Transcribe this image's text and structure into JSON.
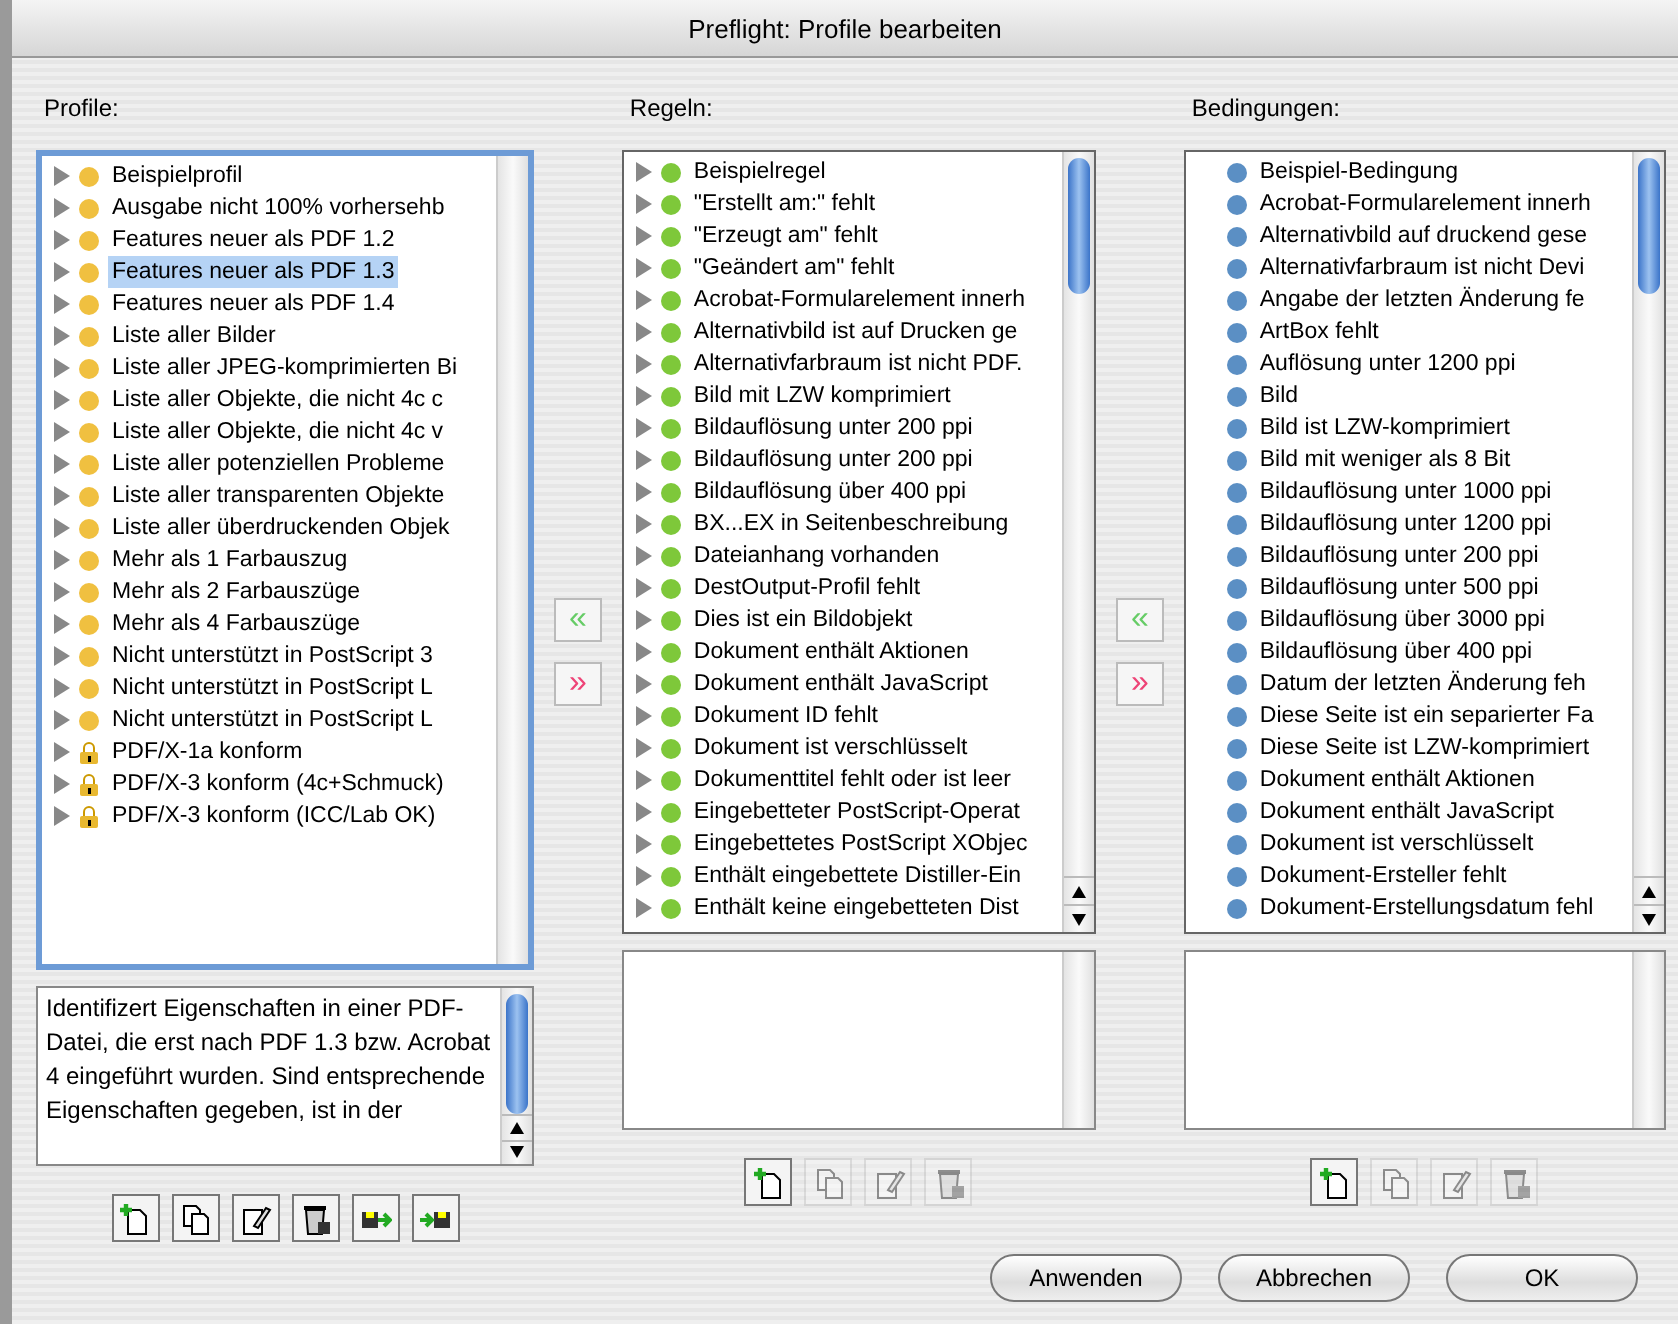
{
  "window": {
    "title": "Preflight: Profile bearbeiten"
  },
  "profiles": {
    "label": "Profile:",
    "items": [
      {
        "label": "Beispielprofil",
        "kind": "profile",
        "selected": false
      },
      {
        "label": "Ausgabe nicht 100% vorhersehb",
        "kind": "profile",
        "selected": false
      },
      {
        "label": "Features neuer als PDF 1.2",
        "kind": "profile",
        "selected": false
      },
      {
        "label": "Features neuer als PDF 1.3",
        "kind": "profile",
        "selected": true
      },
      {
        "label": "Features neuer als PDF 1.4",
        "kind": "profile",
        "selected": false
      },
      {
        "label": "Liste aller Bilder",
        "kind": "profile",
        "selected": false
      },
      {
        "label": "Liste aller JPEG-komprimierten Bi",
        "kind": "profile",
        "selected": false
      },
      {
        "label": "Liste aller Objekte, die nicht 4c c",
        "kind": "profile",
        "selected": false
      },
      {
        "label": "Liste aller Objekte, die nicht 4c v",
        "kind": "profile",
        "selected": false
      },
      {
        "label": "Liste aller potenziellen Probleme",
        "kind": "profile",
        "selected": false
      },
      {
        "label": "Liste aller transparenten Objekte",
        "kind": "profile",
        "selected": false
      },
      {
        "label": "Liste aller überdruckenden Objek",
        "kind": "profile",
        "selected": false
      },
      {
        "label": "Mehr als 1 Farbauszug",
        "kind": "profile",
        "selected": false
      },
      {
        "label": "Mehr als 2 Farbauszüge",
        "kind": "profile",
        "selected": false
      },
      {
        "label": "Mehr als 4 Farbauszüge",
        "kind": "profile",
        "selected": false
      },
      {
        "label": "Nicht unterstützt in PostScript 3",
        "kind": "profile",
        "selected": false
      },
      {
        "label": "Nicht unterstützt in PostScript L",
        "kind": "profile",
        "selected": false
      },
      {
        "label": "Nicht unterstützt in PostScript L",
        "kind": "profile",
        "selected": false
      },
      {
        "label": "PDF/X-1a konform",
        "kind": "locked",
        "selected": false
      },
      {
        "label": "PDF/X-3 konform (4c+Schmuck)",
        "kind": "locked",
        "selected": false
      },
      {
        "label": "PDF/X-3 konform (ICC/Lab OK)",
        "kind": "locked",
        "selected": false
      }
    ],
    "description": "Identifizert Eigenschaften in einer PDF-Datei, die erst nach PDF 1.3 bzw. Acrobat 4 eingeführt wurden. Sind entsprechende Eigenschaften gegeben, ist in der",
    "tools": [
      {
        "kind": "new",
        "disabled": false
      },
      {
        "kind": "duplicate",
        "disabled": false
      },
      {
        "kind": "edit",
        "disabled": false
      },
      {
        "kind": "delete",
        "disabled": false
      },
      {
        "kind": "export",
        "disabled": false
      },
      {
        "kind": "import",
        "disabled": false
      }
    ]
  },
  "transfer_1": {
    "add": "«",
    "remove": "»"
  },
  "rules": {
    "label": "Regeln:",
    "items": [
      "Beispielregel",
      "\"Erstellt am:\" fehlt",
      "\"Erzeugt am\" fehlt",
      "\"Geändert am\" fehlt",
      "Acrobat-Formularelement innerh",
      "Alternativbild ist auf Drucken ge",
      "Alternativfarbraum ist nicht PDF.",
      "Bild mit LZW komprimiert",
      "Bildauflösung unter 200 ppi",
      "Bildauflösung unter 200 ppi",
      "Bildauflösung über 400 ppi",
      "BX...EX in Seitenbeschreibung",
      "Dateianhang vorhanden",
      "DestOutput-Profil fehlt",
      "Dies ist ein Bildobjekt",
      "Dokument enthält Aktionen",
      "Dokument enthält JavaScript",
      "Dokument ID fehlt",
      "Dokument ist verschlüsselt",
      "Dokumenttitel fehlt oder ist leer",
      "Eingebetteter PostScript-Operat",
      "Eingebettetes PostScript XObjec",
      "Enthält eingebettete Distiller-Ein",
      "Enthält keine eingebetteten Dist"
    ],
    "tools": [
      {
        "kind": "new",
        "disabled": false
      },
      {
        "kind": "duplicate",
        "disabled": true
      },
      {
        "kind": "edit",
        "disabled": true
      },
      {
        "kind": "delete",
        "disabled": true
      }
    ]
  },
  "transfer_2": {
    "add": "«",
    "remove": "»"
  },
  "conditions": {
    "label": "Bedingungen:",
    "items": [
      "Beispiel-Bedingung",
      "Acrobat-Formularelement innerh",
      "Alternativbild auf druckend gese",
      "Alternativfarbraum ist nicht Devi",
      "Angabe der letzten Änderung fe",
      "ArtBox fehlt",
      "Auflösung unter 1200 ppi",
      "Bild",
      "Bild ist LZW-komprimiert",
      "Bild mit weniger als 8 Bit",
      "Bildauflösung unter 1000 ppi",
      "Bildauflösung unter 1200 ppi",
      "Bildauflösung unter 200 ppi",
      "Bildauflösung unter 500 ppi",
      "Bildauflösung über 3000 ppi",
      "Bildauflösung über 400 ppi",
      "Datum der letzten Änderung feh",
      "Diese Seite ist ein separierter Fa",
      "Diese Seite ist LZW-komprimiert",
      "Dokument enthält Aktionen",
      "Dokument enthält JavaScript",
      "Dokument ist verschlüsselt",
      "Dokument-Ersteller fehlt",
      "Dokument-Erstellungsdatum fehl"
    ],
    "tools": [
      {
        "kind": "new",
        "disabled": false
      },
      {
        "kind": "duplicate",
        "disabled": true
      },
      {
        "kind": "edit",
        "disabled": true
      },
      {
        "kind": "delete",
        "disabled": true
      }
    ]
  },
  "buttons": [
    "Anwenden",
    "Abbrechen",
    "OK"
  ]
}
